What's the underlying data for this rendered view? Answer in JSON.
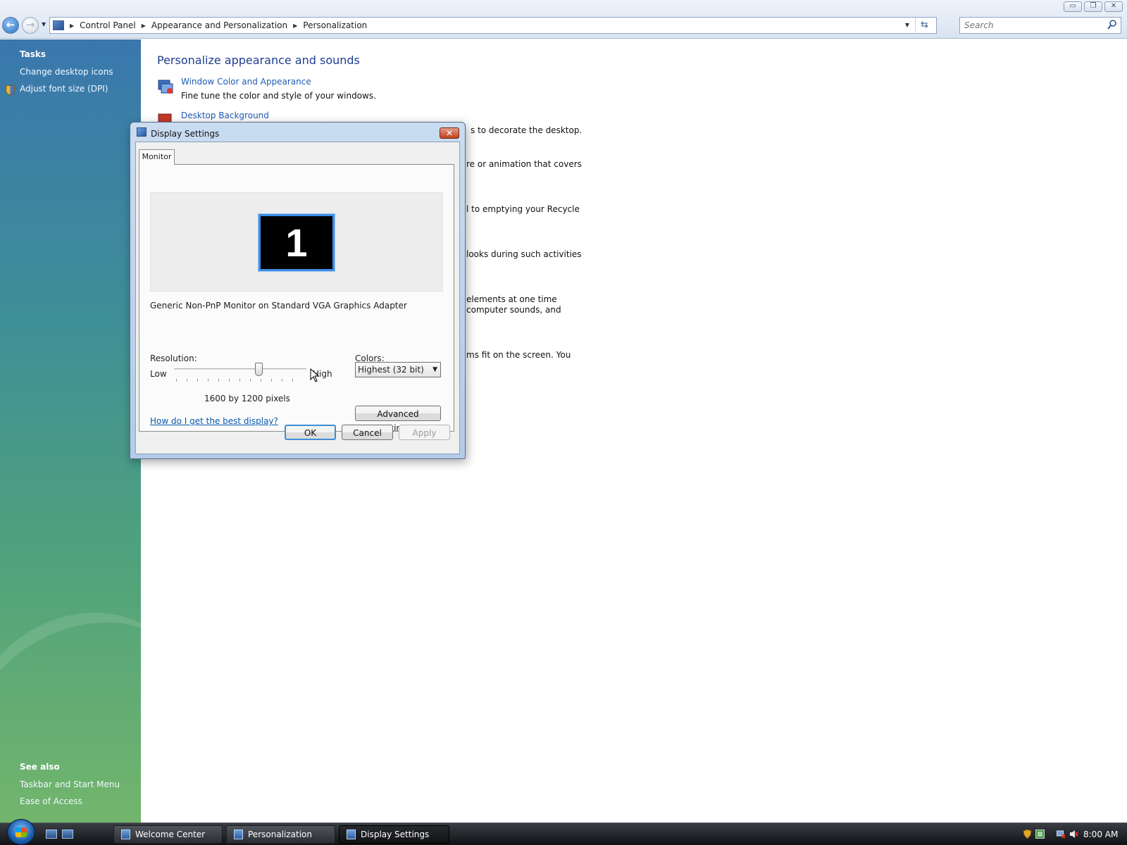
{
  "window": {
    "minimize_label": "▭",
    "restore_label": "❐",
    "close_label": "✕"
  },
  "address_bar": {
    "breadcrumbs": [
      "Control Panel",
      "Appearance and Personalization",
      "Personalization"
    ],
    "search_placeholder": "Search"
  },
  "tasks": {
    "heading": "Tasks",
    "items": [
      {
        "label": "Change desktop icons"
      },
      {
        "label": "Adjust font size (DPI)"
      }
    ]
  },
  "see_also": {
    "heading": "See also",
    "items": [
      {
        "label": "Taskbar and Start Menu"
      },
      {
        "label": "Ease of Access"
      }
    ]
  },
  "main": {
    "title": "Personalize appearance and sounds",
    "items": [
      {
        "link": "Window Color and Appearance",
        "desc": "Fine tune the color and style of your windows."
      },
      {
        "link": "Desktop Background"
      }
    ],
    "partial_texts": [
      "s to decorate the desktop.",
      "re or animation that covers",
      "l to emptying your Recycle",
      "looks during such activities",
      "elements at one time",
      "computer sounds, and",
      "ms fit on the screen. You"
    ]
  },
  "dialog": {
    "title": "Display Settings",
    "close_label": "✕",
    "tab": "Monitor",
    "monitor_number": "1",
    "adapter": "Generic Non-PnP Monitor on Standard VGA Graphics Adapter",
    "resolution_label": "Resolution:",
    "low_label": "Low",
    "high_label": "High",
    "resolution_value": "1600 by 1200 pixels",
    "resolution_slider_fraction": 0.64,
    "colors_label": "Colors:",
    "colors_value": "Highest (32 bit)",
    "help_link": "How do I get the best display?",
    "advanced_button": "Advanced Settings...",
    "ok_button": "OK",
    "cancel_button": "Cancel",
    "apply_button": "Apply"
  },
  "taskbar": {
    "buttons": [
      {
        "label": "Welcome Center"
      },
      {
        "label": "Personalization"
      },
      {
        "label": "Display Settings"
      }
    ],
    "active_button": "Display Settings",
    "clock": "8:00 AM"
  },
  "colors": {
    "link": "#1e5bb5",
    "title_blue": "#1e3d8f",
    "pane_top": "#3a77ad",
    "pane_bottom": "#72b56c",
    "monitor_border": "#3d8ee6"
  }
}
